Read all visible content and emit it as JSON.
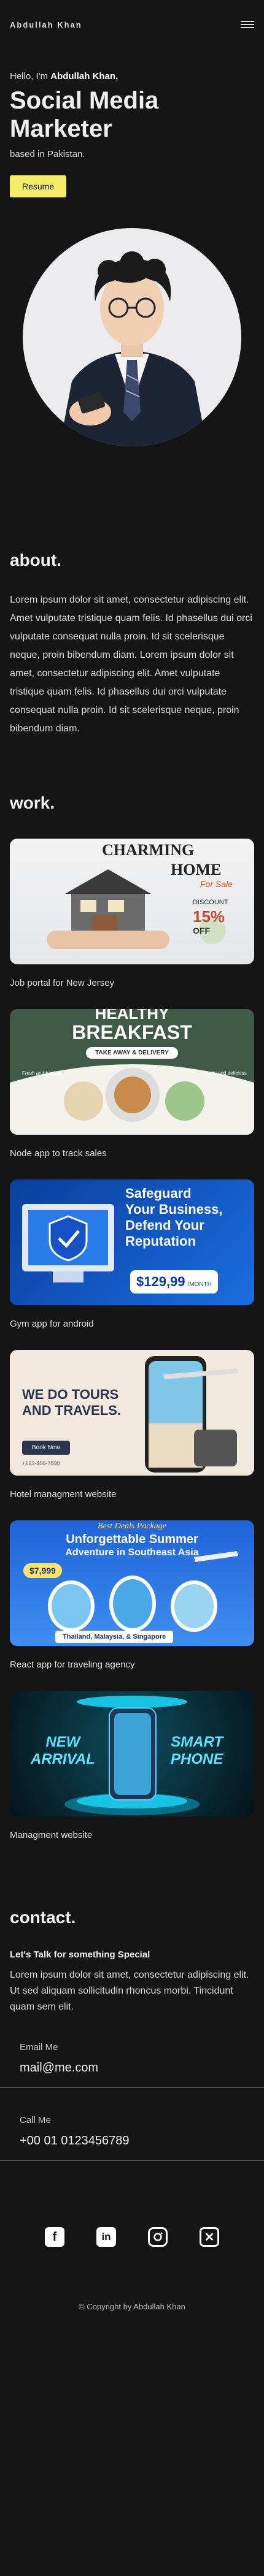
{
  "header": {
    "logo": "Abdullah Khan",
    "menu_icon": "hamburger-menu-icon"
  },
  "hero": {
    "greeting_prefix": "Hello, I'm ",
    "name": "Abdullah Khan,",
    "title": "Social Media Marketer",
    "location": "based in Pakistan.",
    "resume_label": "Resume"
  },
  "about": {
    "title": "about.",
    "text": "Lorem ipsum dolor sit amet, consectetur adipiscing elit. Amet vulputate tristique quam felis. Id phasellus dui orci vulputate consequat nulla proin. Id sit scelerisque neque, proin bibendum diam. Lorem ipsum dolor sit amet, consectetur adipiscing elit. Amet vulputate tristique quam felis. Id phasellus dui orci vulputate consequat nulla proin. Id sit scelerisque neque, proin bibendum diam."
  },
  "work": {
    "title": "work.",
    "projects": [
      {
        "caption": "Job portal for New Jersey",
        "lines": [
          "CHARMING",
          "HOME",
          "For Sale",
          "DISCOUNT",
          "15%",
          "OFF"
        ]
      },
      {
        "caption": "Node app to track sales",
        "lines": [
          "HEALTHY",
          "BREAKFAST",
          "TAKE AWAY & DELIVERY",
          "Fresh and healthy",
          "tasty and delicious"
        ]
      },
      {
        "caption": "Gym app for android",
        "lines": [
          "Safeguard",
          "Your Business,",
          "Defend Your",
          "Reputation",
          "$129,99",
          "/MONTH"
        ]
      },
      {
        "caption": "Hotel managment website",
        "lines": [
          "WE DO TOURS",
          "AND TRAVELS.",
          "Book Now",
          "+123-456-7890"
        ]
      },
      {
        "caption": "React app for traveling agency",
        "lines": [
          "Best Deals Package",
          "Unforgettable Summer",
          "Adventure in Southeast Asia",
          "$7,999",
          "Thailand, Malaysia, & Singapore"
        ]
      },
      {
        "caption": "Managment website",
        "lines": [
          "NEW",
          "ARRIVAL",
          "SMART",
          "PHONE"
        ]
      }
    ]
  },
  "contact": {
    "title": "contact.",
    "subtitle": "Let's Talk for something Special",
    "text": "Lorem ipsum dolor sit amet, consectetur adipiscing elit. Ut sed aliquam sollicitudin rhoncus morbi. Tincidunt quam sem elit.",
    "email_label": "Email Me",
    "email": "mail@me.com",
    "phone_label": "Call Me",
    "phone": "+00 01 0123456789",
    "socials": [
      {
        "name": "facebook-icon",
        "glyph": "f"
      },
      {
        "name": "linkedin-icon",
        "glyph": "in"
      },
      {
        "name": "instagram-icon",
        "glyph": "◎"
      },
      {
        "name": "x-icon",
        "glyph": "✕"
      }
    ],
    "copyright": "© Copyright by Abdullah Khan"
  },
  "colors": {
    "background": "#151515",
    "accent": "#f7ec6a",
    "text": "#e8e8e8"
  }
}
